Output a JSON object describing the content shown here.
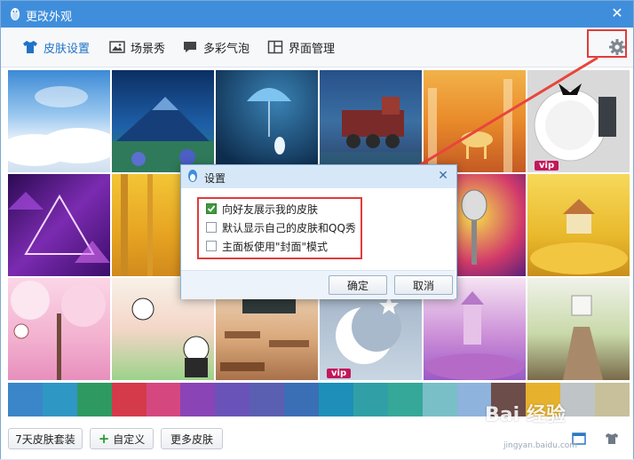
{
  "window": {
    "title": "更改外观",
    "close": "✕"
  },
  "tabs": [
    {
      "label": "皮肤设置",
      "icon": "shirt-icon",
      "active": true
    },
    {
      "label": "场景秀",
      "icon": "picture-icon"
    },
    {
      "label": "多彩气泡",
      "icon": "chat-bubble-icon"
    },
    {
      "label": "界面管理",
      "icon": "layout-icon"
    }
  ],
  "skins": [
    {
      "name": "sky-clouds",
      "vip": ""
    },
    {
      "name": "blue-mountain",
      "vip": ""
    },
    {
      "name": "umbrella-rabbit",
      "vip": ""
    },
    {
      "name": "night-train",
      "vip": ""
    },
    {
      "name": "autumn-deer",
      "vip": ""
    },
    {
      "name": "dinner-plate",
      "vip": "vip"
    },
    {
      "name": "purple-triangles",
      "vip": ""
    },
    {
      "name": "golden-forest",
      "vip": ""
    },
    {
      "name": "hidden-1",
      "vip": ""
    },
    {
      "name": "hidden-2",
      "vip": ""
    },
    {
      "name": "microphone",
      "vip": ""
    },
    {
      "name": "yellow-house",
      "vip": ""
    },
    {
      "name": "cherry-blossom",
      "vip": ""
    },
    {
      "name": "cats-meadow",
      "vip": ""
    },
    {
      "name": "classroom",
      "vip": ""
    },
    {
      "name": "moon-star",
      "vip": "vip"
    },
    {
      "name": "purple-castle",
      "vip": ""
    },
    {
      "name": "wooden-bridge",
      "vip": ""
    }
  ],
  "swatch_colors": [
    "#3b86c8",
    "#2f97c4",
    "#2e9a62",
    "#d43a4a",
    "#d5487f",
    "#8a44b6",
    "#6a53b8",
    "#5b5fb2",
    "#3a6fb6",
    "#1e8fb8",
    "#30a0a6",
    "#35a89a",
    "#79bfc7",
    "#8eb3dc",
    "#6d4d4a",
    "#e6b12d",
    "#bfc4c6",
    "#c7c09a"
  ],
  "bottom": {
    "suit_label": "7天皮肤套装",
    "custom_label": "自定义",
    "more_label": "更多皮肤"
  },
  "dialog": {
    "title": "设置",
    "close": "✕",
    "options": [
      {
        "label": "向好友展示我的皮肤",
        "checked": true
      },
      {
        "label": "默认显示自己的皮肤和QQ秀",
        "checked": false
      },
      {
        "label": "主面板使用\"封面\"模式",
        "checked": false
      }
    ],
    "ok": "确定",
    "cancel": "取消"
  },
  "watermark": {
    "main": "Bai 经验",
    "sub": "jingyan.baidu.com"
  },
  "colors": {
    "title_bar": "#3f8edc",
    "accent": "#1f73c6",
    "highlight_red": "#e23b3b",
    "arrow_red": "#e8453c"
  }
}
